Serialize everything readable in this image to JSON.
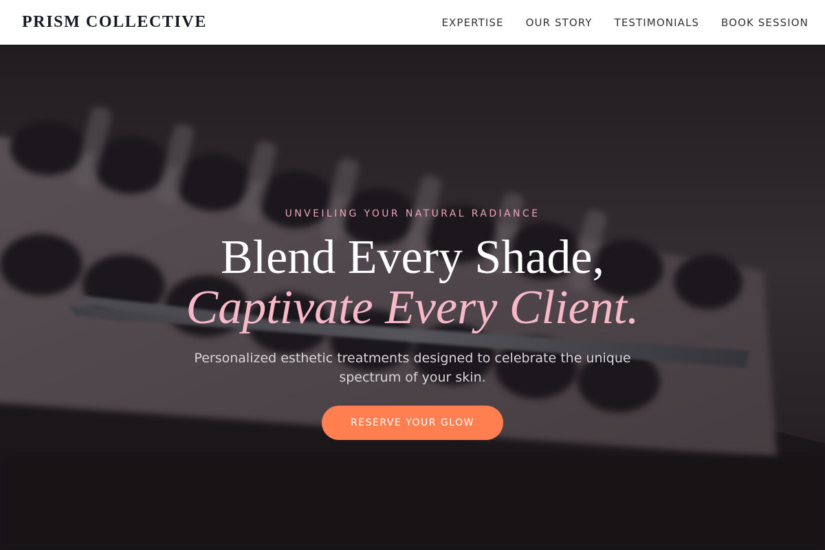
{
  "header": {
    "brand": "PRISM COLLECTIVE",
    "nav": [
      {
        "label": "EXPERTISE"
      },
      {
        "label": "OUR STORY"
      },
      {
        "label": "TESTIMONIALS"
      },
      {
        "label": "BOOK SESSION"
      }
    ]
  },
  "hero": {
    "eyebrow": "UNVEILING YOUR NATURAL RADIANCE",
    "headline_line1": "Blend Every Shade,",
    "headline_line2": "Captivate Every Client.",
    "subtitle": "Personalized esthetic treatments designed to celebrate the unique spectrum of your skin.",
    "cta_label": "RESERVE YOUR GLOW",
    "background_image": "makeup-palette-photo"
  },
  "colors": {
    "accent": "#ff7f50",
    "eyebrow_pink": "#f0a3b6",
    "headline_pink": "#f7b8c8",
    "header_bg": "#ffffff",
    "brand_text": "#161a24"
  }
}
